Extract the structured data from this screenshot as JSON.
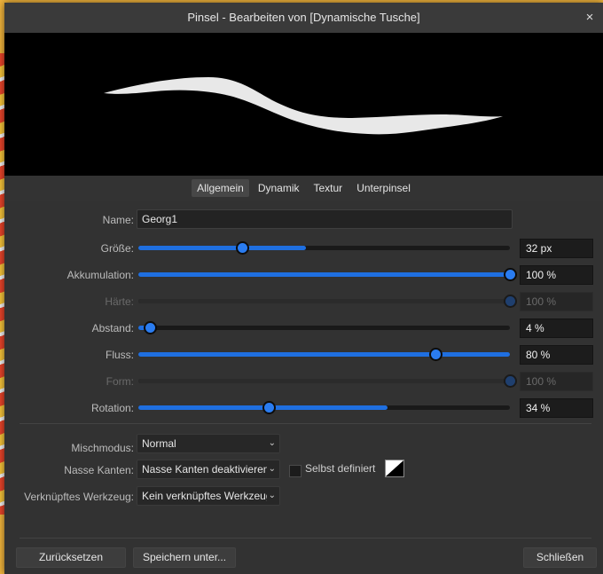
{
  "dialog": {
    "title": "Pinsel - Bearbeiten von [Dynamische Tusche]",
    "close_glyph": "×"
  },
  "tabs": [
    {
      "label": "Allgemein",
      "active": true
    },
    {
      "label": "Dynamik",
      "active": false
    },
    {
      "label": "Textur",
      "active": false
    },
    {
      "label": "Unterpinsel",
      "active": false
    }
  ],
  "name": {
    "label": "Name:",
    "value": "Georg1"
  },
  "sliders": {
    "groesse": {
      "label": "Größe:",
      "value": "32 px",
      "fill": 0.45,
      "knob": 0.28,
      "enabled": true
    },
    "akkumulation": {
      "label": "Akkumulation:",
      "value": "100 %",
      "fill": 1.0,
      "knob": 1.0,
      "enabled": true
    },
    "haerte": {
      "label": "Härte:",
      "value": "100 %",
      "fill": 1.0,
      "knob": 1.0,
      "enabled": false
    },
    "abstand": {
      "label": "Abstand:",
      "value": "4 %",
      "fill": 0.03,
      "knob": 0.03,
      "enabled": true
    },
    "fluss": {
      "label": "Fluss:",
      "value": "80 %",
      "fill": 1.0,
      "knob": 0.8,
      "enabled": true
    },
    "form": {
      "label": "Form:",
      "value": "100 %",
      "fill": 1.0,
      "knob": 1.0,
      "enabled": false
    },
    "rotation": {
      "label": "Rotation:",
      "value": "34 %",
      "fill": 0.67,
      "knob": 0.35,
      "enabled": true
    }
  },
  "mischmodus": {
    "label": "Mischmodus:",
    "value": "Normal"
  },
  "nasse_kanten": {
    "label": "Nasse Kanten:",
    "value": "Nasse Kanten deaktivieren",
    "checkbox_label": "Selbst definiert",
    "checked": false
  },
  "werkzeug": {
    "label": "Verknüpftes Werkzeug:",
    "value": "Kein verknüpftes Werkzeug"
  },
  "buttons": {
    "reset": "Zurücksetzen",
    "save_as": "Speichern unter...",
    "close": "Schließen"
  },
  "colors": {
    "accent": "#1f6fe0",
    "knob": "#2a7cf0",
    "dialog_bg": "#323232"
  },
  "icons": {
    "close": "close-icon",
    "dropdown": "chevron-down-icon",
    "swatch": "color-swatch-icon"
  }
}
